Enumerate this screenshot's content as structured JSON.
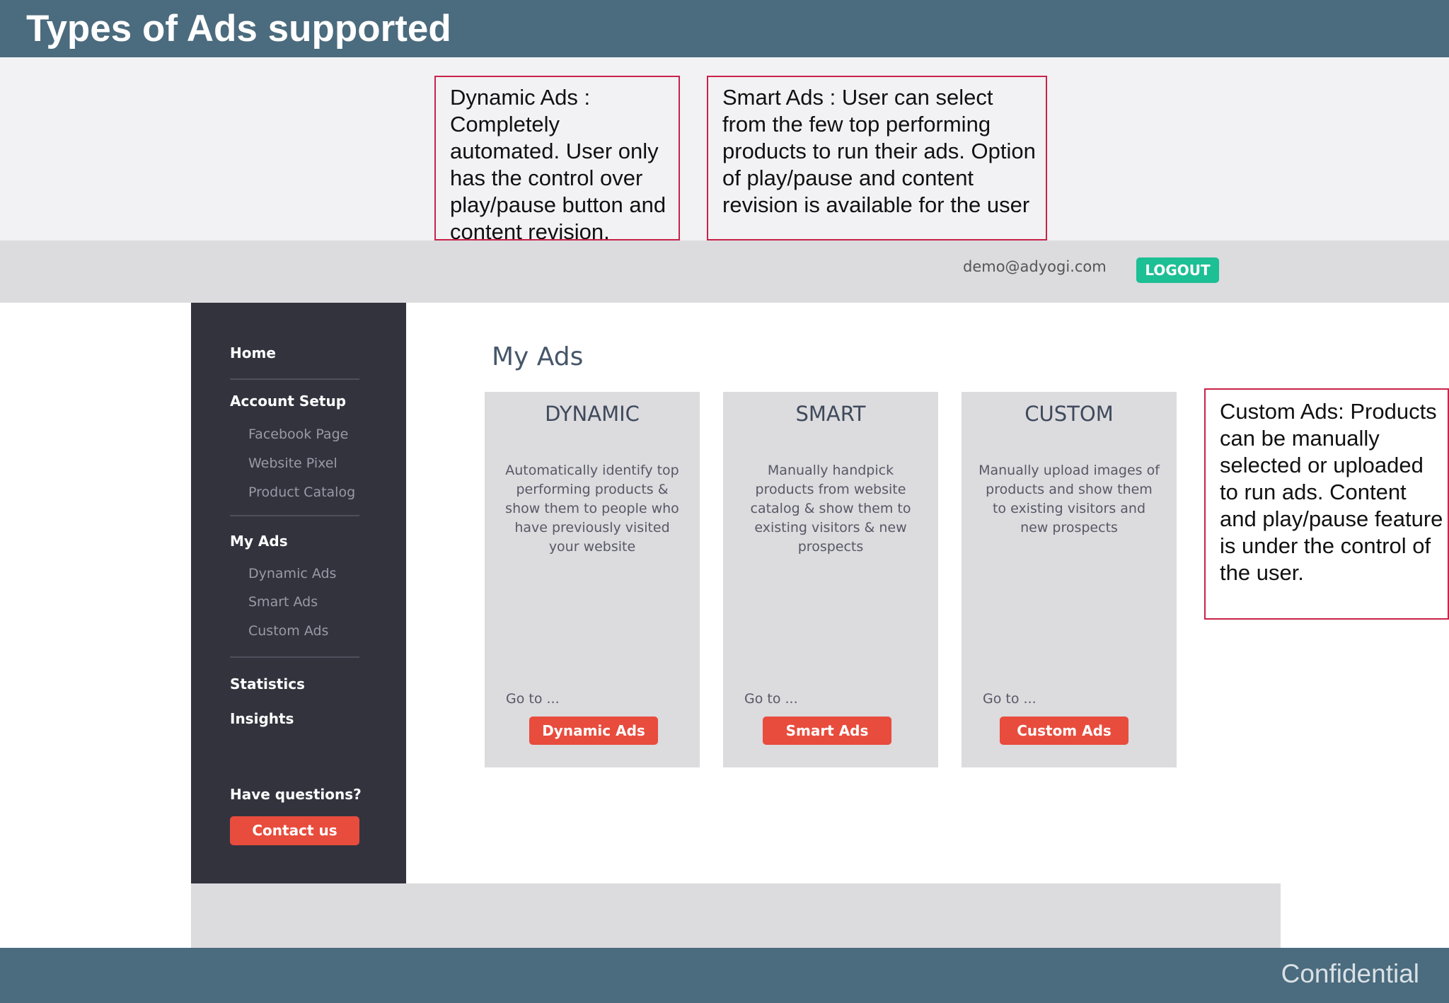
{
  "slide": {
    "title": "Types of Ads supported",
    "footer": "Confidential"
  },
  "callouts": {
    "dynamic": "Dynamic Ads : Completely automated. User only has the control over play/pause button and content revision.",
    "smart": "Smart Ads : User can select from the few top performing products to run their ads. Option of play/pause and content revision is available for the user",
    "custom": "Custom Ads: Products can be manually selected or uploaded to run ads. Content and play/pause feature is under the control of the user."
  },
  "header": {
    "email": "demo@adyogi.com",
    "logout_label": "LOGOUT"
  },
  "sidebar": {
    "home": "Home",
    "account_setup": "Account Setup",
    "facebook_page": "Facebook Page",
    "website_pixel": "Website Pixel",
    "product_catalog": "Product Catalog",
    "my_ads": "My Ads",
    "dynamic_ads": "Dynamic Ads",
    "smart_ads": "Smart Ads",
    "custom_ads": "Custom Ads",
    "statistics": "Statistics",
    "insights": "Insights",
    "have_questions": "Have questions?",
    "contact_label": "Contact us"
  },
  "main": {
    "heading": "My Ads",
    "cards": [
      {
        "title": "DYNAMIC",
        "description": "Automatically identify top performing products & show them to people who have previously visited your website",
        "goto": "Go to ...",
        "button": "Dynamic Ads"
      },
      {
        "title": "SMART",
        "description": "Manually handpick products from website catalog & show them to existing visitors & new prospects",
        "goto": "Go to ...",
        "button": "Smart Ads"
      },
      {
        "title": "CUSTOM",
        "description": "Manually upload images of products and show them to existing visitors and new prospects",
        "goto": "Go to ...",
        "button": "Custom Ads"
      }
    ]
  },
  "colors": {
    "title_bar": "#4b6b7e",
    "sidebar": "#33333e",
    "accent_red": "#e84c3d",
    "logout_green": "#1dbf95",
    "callout_border": "#c8234a"
  }
}
